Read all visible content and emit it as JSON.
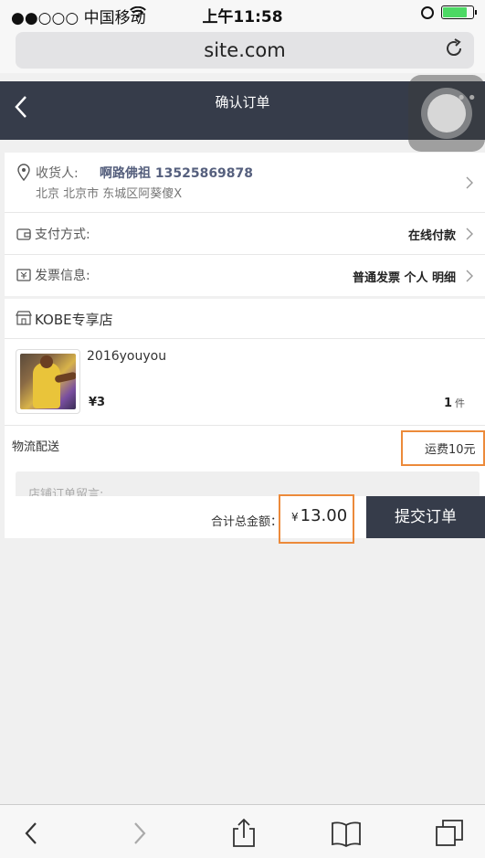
{
  "status_bar": {
    "carrier": "●●○○○ 中国移动",
    "time": "上午11:58"
  },
  "browser": {
    "url": "site.com"
  },
  "nav": {
    "title": "确认订单",
    "more": "•••"
  },
  "address": {
    "label": "收货人:",
    "name_phone": "啊路佛祖  13525869878",
    "detail": "北京 北京市 东城区阿葵傻X"
  },
  "payment": {
    "label": "支付方式:",
    "value": "在线付款"
  },
  "invoice": {
    "label": "发票信息:",
    "value": "普通发票  个人  明细"
  },
  "shop": {
    "name": "KOBE专享店"
  },
  "product": {
    "name": "2016youyou",
    "price": "¥3",
    "quantity": "1",
    "unit": "件"
  },
  "shipping": {
    "label": "物流配送",
    "fee": "运费10元"
  },
  "note": {
    "placeholder": "店铺订单留言:"
  },
  "summary": {
    "total_label": "合计总金额：",
    "currency": "¥",
    "total_amount": "13.00",
    "submit_label": "提交订单"
  },
  "colors": {
    "nav_bg": "#363c4a",
    "highlight": "#ec8a3a"
  }
}
